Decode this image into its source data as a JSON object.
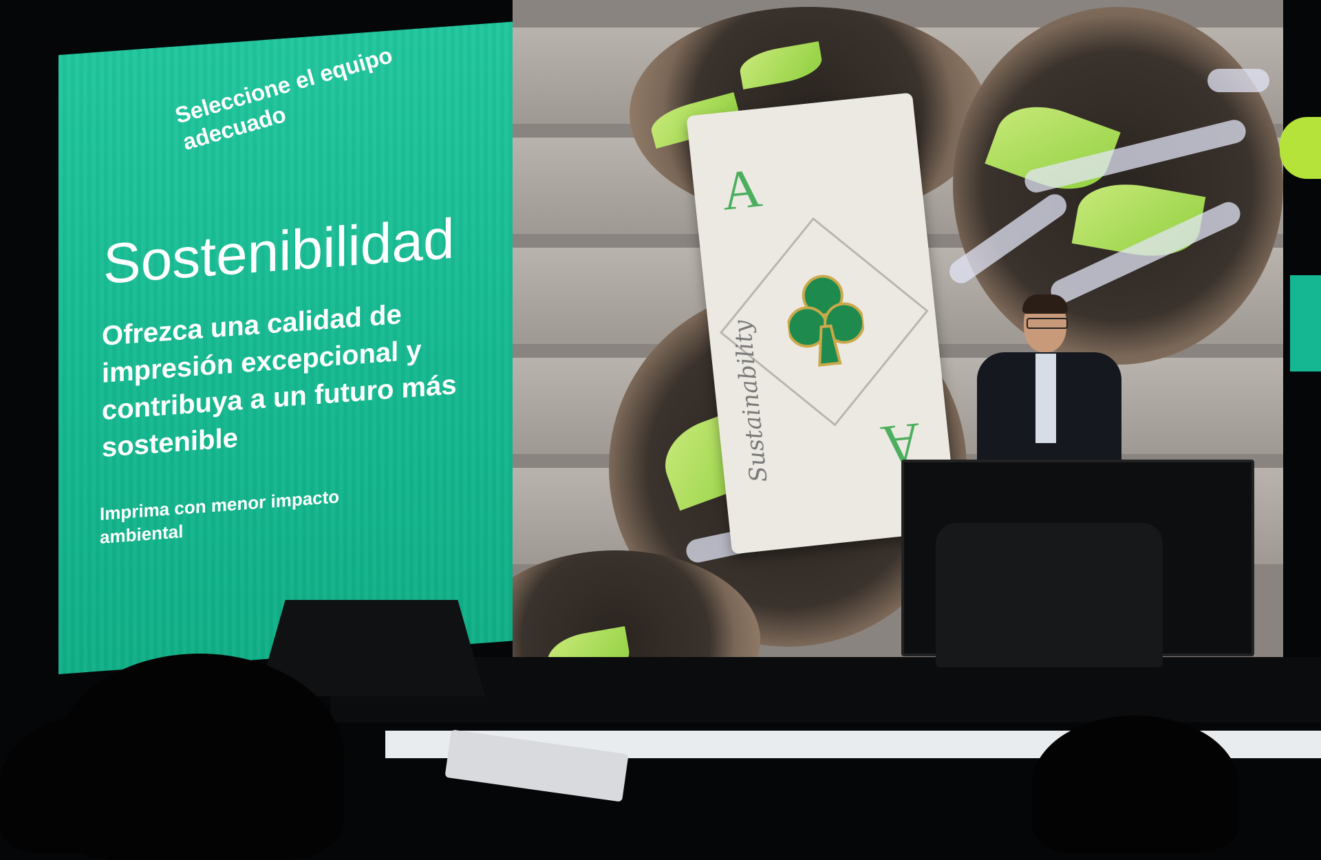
{
  "slide": {
    "subtitle": "Seleccione el equipo adecuado",
    "title": "Sostenibilidad",
    "body": "Ofrezca una calidad de impresión excepcional y contribuya a un futuro más sostenible",
    "small": "Imprima con menor impacto ambiental",
    "card_rank": "A",
    "card_script": "Sustainability"
  },
  "colors": {
    "teal": "#1fc59c",
    "card_green": "#4caf5e",
    "leaf_green": "#a8dc5a"
  }
}
